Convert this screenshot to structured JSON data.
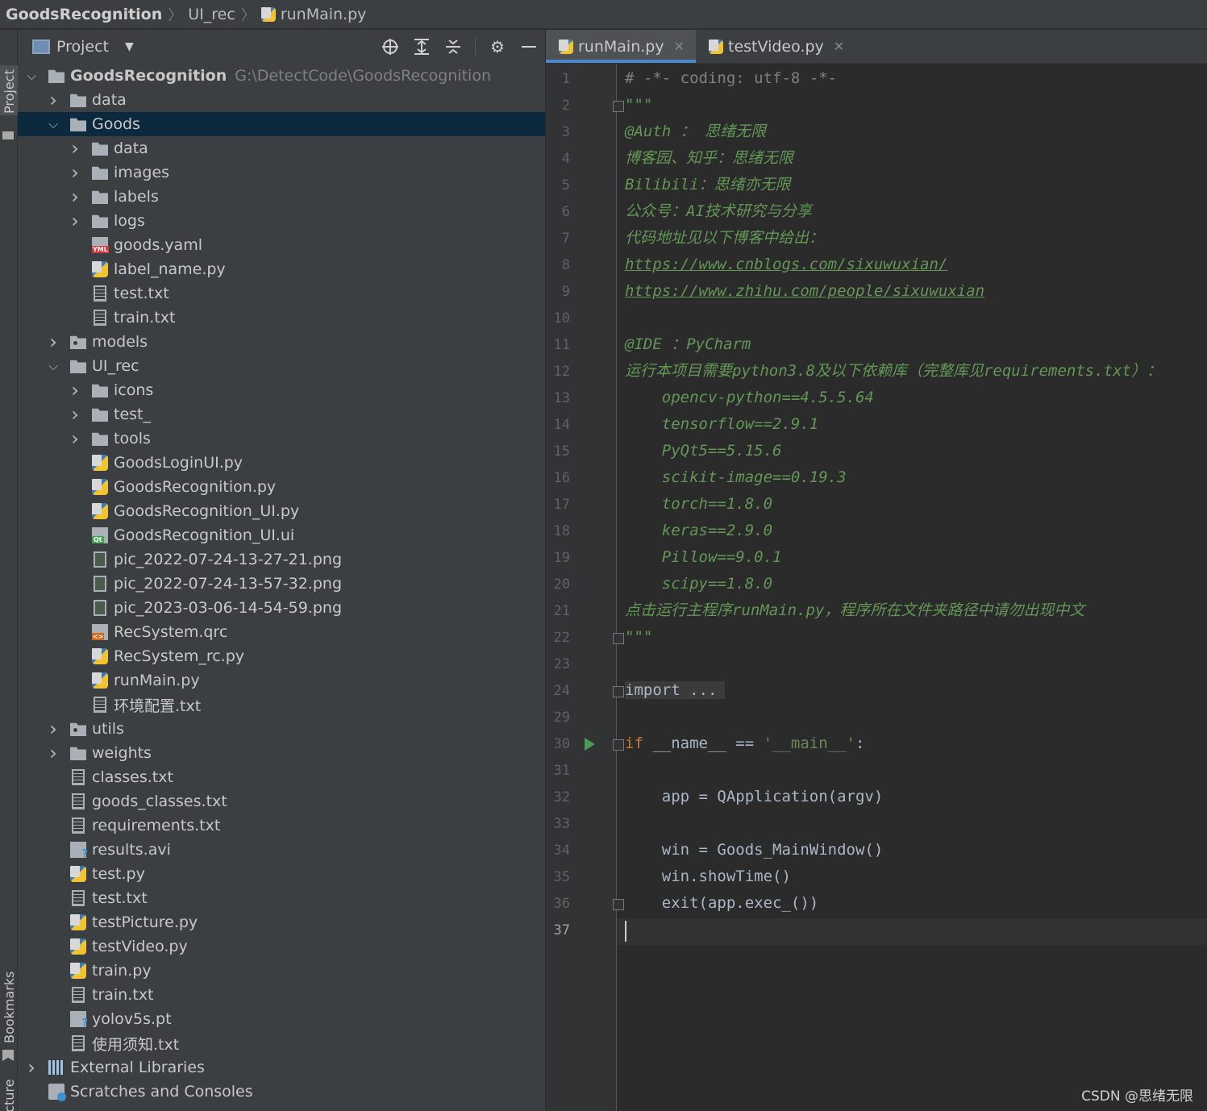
{
  "breadcrumb": {
    "project": "GoodsRecognition",
    "folder": "UI_rec",
    "file": "runMain.py"
  },
  "side_tabs": {
    "project": "Project",
    "bookmarks": "Bookmarks",
    "structure": "Structure"
  },
  "project_panel": {
    "title": "Project"
  },
  "tree": [
    {
      "depth": 0,
      "arrow": "down",
      "icon": "folder",
      "label": "GoodsRecognition",
      "path": "G:\\DetectCode\\GoodsRecognition",
      "bold": true
    },
    {
      "depth": 1,
      "arrow": "right",
      "icon": "folder",
      "label": "data"
    },
    {
      "depth": 1,
      "arrow": "down",
      "icon": "folder",
      "label": "Goods",
      "selected": true
    },
    {
      "depth": 2,
      "arrow": "right",
      "icon": "folder",
      "label": "data"
    },
    {
      "depth": 2,
      "arrow": "right",
      "icon": "folder",
      "label": "images"
    },
    {
      "depth": 2,
      "arrow": "right",
      "icon": "folder",
      "label": "labels"
    },
    {
      "depth": 2,
      "arrow": "right",
      "icon": "folder",
      "label": "logs"
    },
    {
      "depth": 2,
      "arrow": "none",
      "icon": "yaml",
      "label": "goods.yaml"
    },
    {
      "depth": 2,
      "arrow": "none",
      "icon": "py",
      "label": "label_name.py"
    },
    {
      "depth": 2,
      "arrow": "none",
      "icon": "file",
      "label": "test.txt"
    },
    {
      "depth": 2,
      "arrow": "none",
      "icon": "file",
      "label": "train.txt"
    },
    {
      "depth": 1,
      "arrow": "right",
      "icon": "folder-dot",
      "label": "models"
    },
    {
      "depth": 1,
      "arrow": "down",
      "icon": "folder",
      "label": "UI_rec"
    },
    {
      "depth": 2,
      "arrow": "right",
      "icon": "folder",
      "label": "icons"
    },
    {
      "depth": 2,
      "arrow": "right",
      "icon": "folder",
      "label": "test_"
    },
    {
      "depth": 2,
      "arrow": "right",
      "icon": "folder",
      "label": "tools"
    },
    {
      "depth": 2,
      "arrow": "none",
      "icon": "py",
      "label": "GoodsLoginUI.py"
    },
    {
      "depth": 2,
      "arrow": "none",
      "icon": "py",
      "label": "GoodsRecognition.py"
    },
    {
      "depth": 2,
      "arrow": "none",
      "icon": "py",
      "label": "GoodsRecognition_UI.py"
    },
    {
      "depth": 2,
      "arrow": "none",
      "icon": "ui",
      "label": "GoodsRecognition_UI.ui"
    },
    {
      "depth": 2,
      "arrow": "none",
      "icon": "img",
      "label": "pic_2022-07-24-13-27-21.png"
    },
    {
      "depth": 2,
      "arrow": "none",
      "icon": "img",
      "label": "pic_2022-07-24-13-57-32.png"
    },
    {
      "depth": 2,
      "arrow": "none",
      "icon": "img",
      "label": "pic_2023-03-06-14-54-59.png"
    },
    {
      "depth": 2,
      "arrow": "none",
      "icon": "qrc",
      "label": "RecSystem.qrc"
    },
    {
      "depth": 2,
      "arrow": "none",
      "icon": "py",
      "label": "RecSystem_rc.py"
    },
    {
      "depth": 2,
      "arrow": "none",
      "icon": "py",
      "label": "runMain.py"
    },
    {
      "depth": 2,
      "arrow": "none",
      "icon": "file",
      "label": "环境配置.txt"
    },
    {
      "depth": 1,
      "arrow": "right",
      "icon": "folder-dot",
      "label": "utils"
    },
    {
      "depth": 1,
      "arrow": "right",
      "icon": "folder",
      "label": "weights"
    },
    {
      "depth": 1,
      "arrow": "none",
      "icon": "file",
      "label": "classes.txt"
    },
    {
      "depth": 1,
      "arrow": "none",
      "icon": "file",
      "label": "goods_classes.txt"
    },
    {
      "depth": 1,
      "arrow": "none",
      "icon": "file",
      "label": "requirements.txt"
    },
    {
      "depth": 1,
      "arrow": "none",
      "icon": "unk",
      "label": "results.avi"
    },
    {
      "depth": 1,
      "arrow": "none",
      "icon": "py",
      "label": "test.py"
    },
    {
      "depth": 1,
      "arrow": "none",
      "icon": "file",
      "label": "test.txt"
    },
    {
      "depth": 1,
      "arrow": "none",
      "icon": "py",
      "label": "testPicture.py"
    },
    {
      "depth": 1,
      "arrow": "none",
      "icon": "py",
      "label": "testVideo.py"
    },
    {
      "depth": 1,
      "arrow": "none",
      "icon": "py",
      "label": "train.py"
    },
    {
      "depth": 1,
      "arrow": "none",
      "icon": "file",
      "label": "train.txt"
    },
    {
      "depth": 1,
      "arrow": "none",
      "icon": "unk",
      "label": "yolov5s.pt"
    },
    {
      "depth": 1,
      "arrow": "none",
      "icon": "file",
      "label": "使用须知.txt"
    },
    {
      "depth": 0,
      "arrow": "right",
      "icon": "lib",
      "label": "External Libraries"
    },
    {
      "depth": 0,
      "arrow": "none",
      "icon": "scratch",
      "label": "Scratches and Consoles"
    }
  ],
  "tabs": [
    {
      "label": "runMain.py",
      "active": true
    },
    {
      "label": "testVideo.py",
      "active": false
    }
  ],
  "code_lines": [
    {
      "n": "1",
      "parts": [
        {
          "c": "comment",
          "t": "# -*- coding: utf-8 -*-"
        }
      ]
    },
    {
      "n": "2",
      "fold": true,
      "parts": [
        {
          "c": "doc",
          "t": "\"\"\""
        }
      ]
    },
    {
      "n": "3",
      "parts": [
        {
          "c": "doc",
          "t": "@Auth ： 思绪无限"
        }
      ]
    },
    {
      "n": "4",
      "parts": [
        {
          "c": "doc",
          "t": "博客园、知乎：思绪无限"
        }
      ]
    },
    {
      "n": "5",
      "parts": [
        {
          "c": "doc",
          "t": "Bilibili：思绪亦无限"
        }
      ]
    },
    {
      "n": "6",
      "parts": [
        {
          "c": "doc",
          "t": "公众号：AI技术研究与分享"
        }
      ]
    },
    {
      "n": "7",
      "parts": [
        {
          "c": "doc",
          "t": "代码地址见以下博客中给出："
        }
      ]
    },
    {
      "n": "8",
      "parts": [
        {
          "c": "doc-url",
          "t": "https://www.cnblogs.com/sixuwuxian/"
        }
      ]
    },
    {
      "n": "9",
      "parts": [
        {
          "c": "doc-url",
          "t": "https://www.zhihu.com/people/sixuwuxian"
        }
      ]
    },
    {
      "n": "10",
      "parts": []
    },
    {
      "n": "11",
      "parts": [
        {
          "c": "doc",
          "t": "@IDE ：PyCharm"
        }
      ]
    },
    {
      "n": "12",
      "parts": [
        {
          "c": "doc",
          "t": "运行本项目需要python3.8及以下依赖库（完整库见requirements.txt）："
        }
      ]
    },
    {
      "n": "13",
      "parts": [
        {
          "c": "doc",
          "t": "    opencv-python==4.5.5.64"
        }
      ]
    },
    {
      "n": "14",
      "parts": [
        {
          "c": "doc",
          "t": "    tensorflow==2.9.1"
        }
      ]
    },
    {
      "n": "15",
      "parts": [
        {
          "c": "doc",
          "t": "    PyQt5==5.15.6"
        }
      ]
    },
    {
      "n": "16",
      "parts": [
        {
          "c": "doc",
          "t": "    scikit-image==0.19.3"
        }
      ]
    },
    {
      "n": "17",
      "parts": [
        {
          "c": "doc",
          "t": "    torch==1.8.0"
        }
      ]
    },
    {
      "n": "18",
      "parts": [
        {
          "c": "doc",
          "t": "    keras==2.9.0"
        }
      ]
    },
    {
      "n": "19",
      "parts": [
        {
          "c": "doc",
          "t": "    Pillow==9.0.1"
        }
      ]
    },
    {
      "n": "20",
      "parts": [
        {
          "c": "doc",
          "t": "    scipy==1.8.0"
        }
      ]
    },
    {
      "n": "21",
      "parts": [
        {
          "c": "doc",
          "t": "点击运行主程序runMain.py，程序所在文件夹路径中请勿出现中文"
        }
      ]
    },
    {
      "n": "22",
      "fold": true,
      "parts": [
        {
          "c": "doc",
          "t": "\"\"\""
        }
      ]
    },
    {
      "n": "23",
      "parts": []
    },
    {
      "n": "24",
      "fold": true,
      "parts": [
        {
          "c": "folded",
          "t": "import ..."
        }
      ]
    },
    {
      "n": "29",
      "parts": []
    },
    {
      "n": "30",
      "fold": true,
      "run": true,
      "parts": [
        {
          "c": "kw",
          "t": "if"
        },
        {
          "c": "plain",
          "t": " __name__ == "
        },
        {
          "c": "str",
          "t": "'__main__'"
        },
        {
          "c": "plain",
          "t": ":"
        }
      ]
    },
    {
      "n": "31",
      "parts": []
    },
    {
      "n": "32",
      "parts": [
        {
          "c": "plain",
          "t": "    app = QApplication(argv)"
        }
      ]
    },
    {
      "n": "33",
      "parts": []
    },
    {
      "n": "34",
      "parts": [
        {
          "c": "plain",
          "t": "    win = Goods_MainWindow()"
        }
      ]
    },
    {
      "n": "35",
      "parts": [
        {
          "c": "plain",
          "t": "    win.showTime()"
        }
      ]
    },
    {
      "n": "36",
      "fold": true,
      "parts": [
        {
          "c": "plain",
          "t": "    exit(app.exec_())"
        }
      ]
    },
    {
      "n": "37",
      "current": true,
      "parts": []
    }
  ],
  "watermark": "CSDN @思绪无限"
}
